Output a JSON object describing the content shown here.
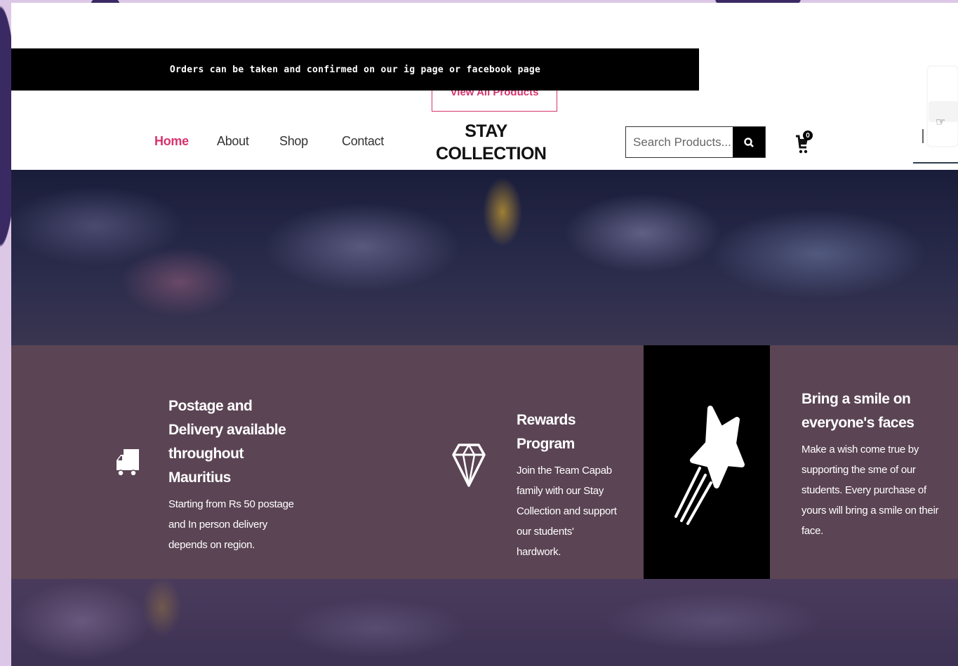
{
  "announcement": "Orders can be taken and confirmed on our ig page or facebook page",
  "view_all_label": "View All Products",
  "nav": {
    "items": [
      {
        "label": "Home",
        "active": true
      },
      {
        "label": "About"
      },
      {
        "label": "Shop"
      },
      {
        "label": "Contact"
      }
    ]
  },
  "logo": {
    "line1": "STAY",
    "line2": "COLLECTION"
  },
  "search": {
    "placeholder": "Search Products...",
    "button_icon": "search-icon"
  },
  "cart": {
    "count": "0",
    "icon": "cart-icon"
  },
  "features": [
    {
      "icon": "truck-icon",
      "title": "Postage and Delivery available throughout Mauritius",
      "text": "Starting from Rs 50 postage and In person delivery depends on region."
    },
    {
      "icon": "diamond-icon",
      "title": "Rewards Program",
      "text": "Join the Team Capab family with our Stay Collection and support our students' hardwork."
    },
    {
      "icon": "shooting-star-icon",
      "title": "Bring a smile on everyone's faces",
      "text": "Make a wish come true by supporting the sme of our students. Every purchase of yours will bring a smile on their face."
    }
  ],
  "colors": {
    "accent": "#d6336c",
    "features_bg": "#5b4454",
    "announce_bg": "#000000"
  }
}
